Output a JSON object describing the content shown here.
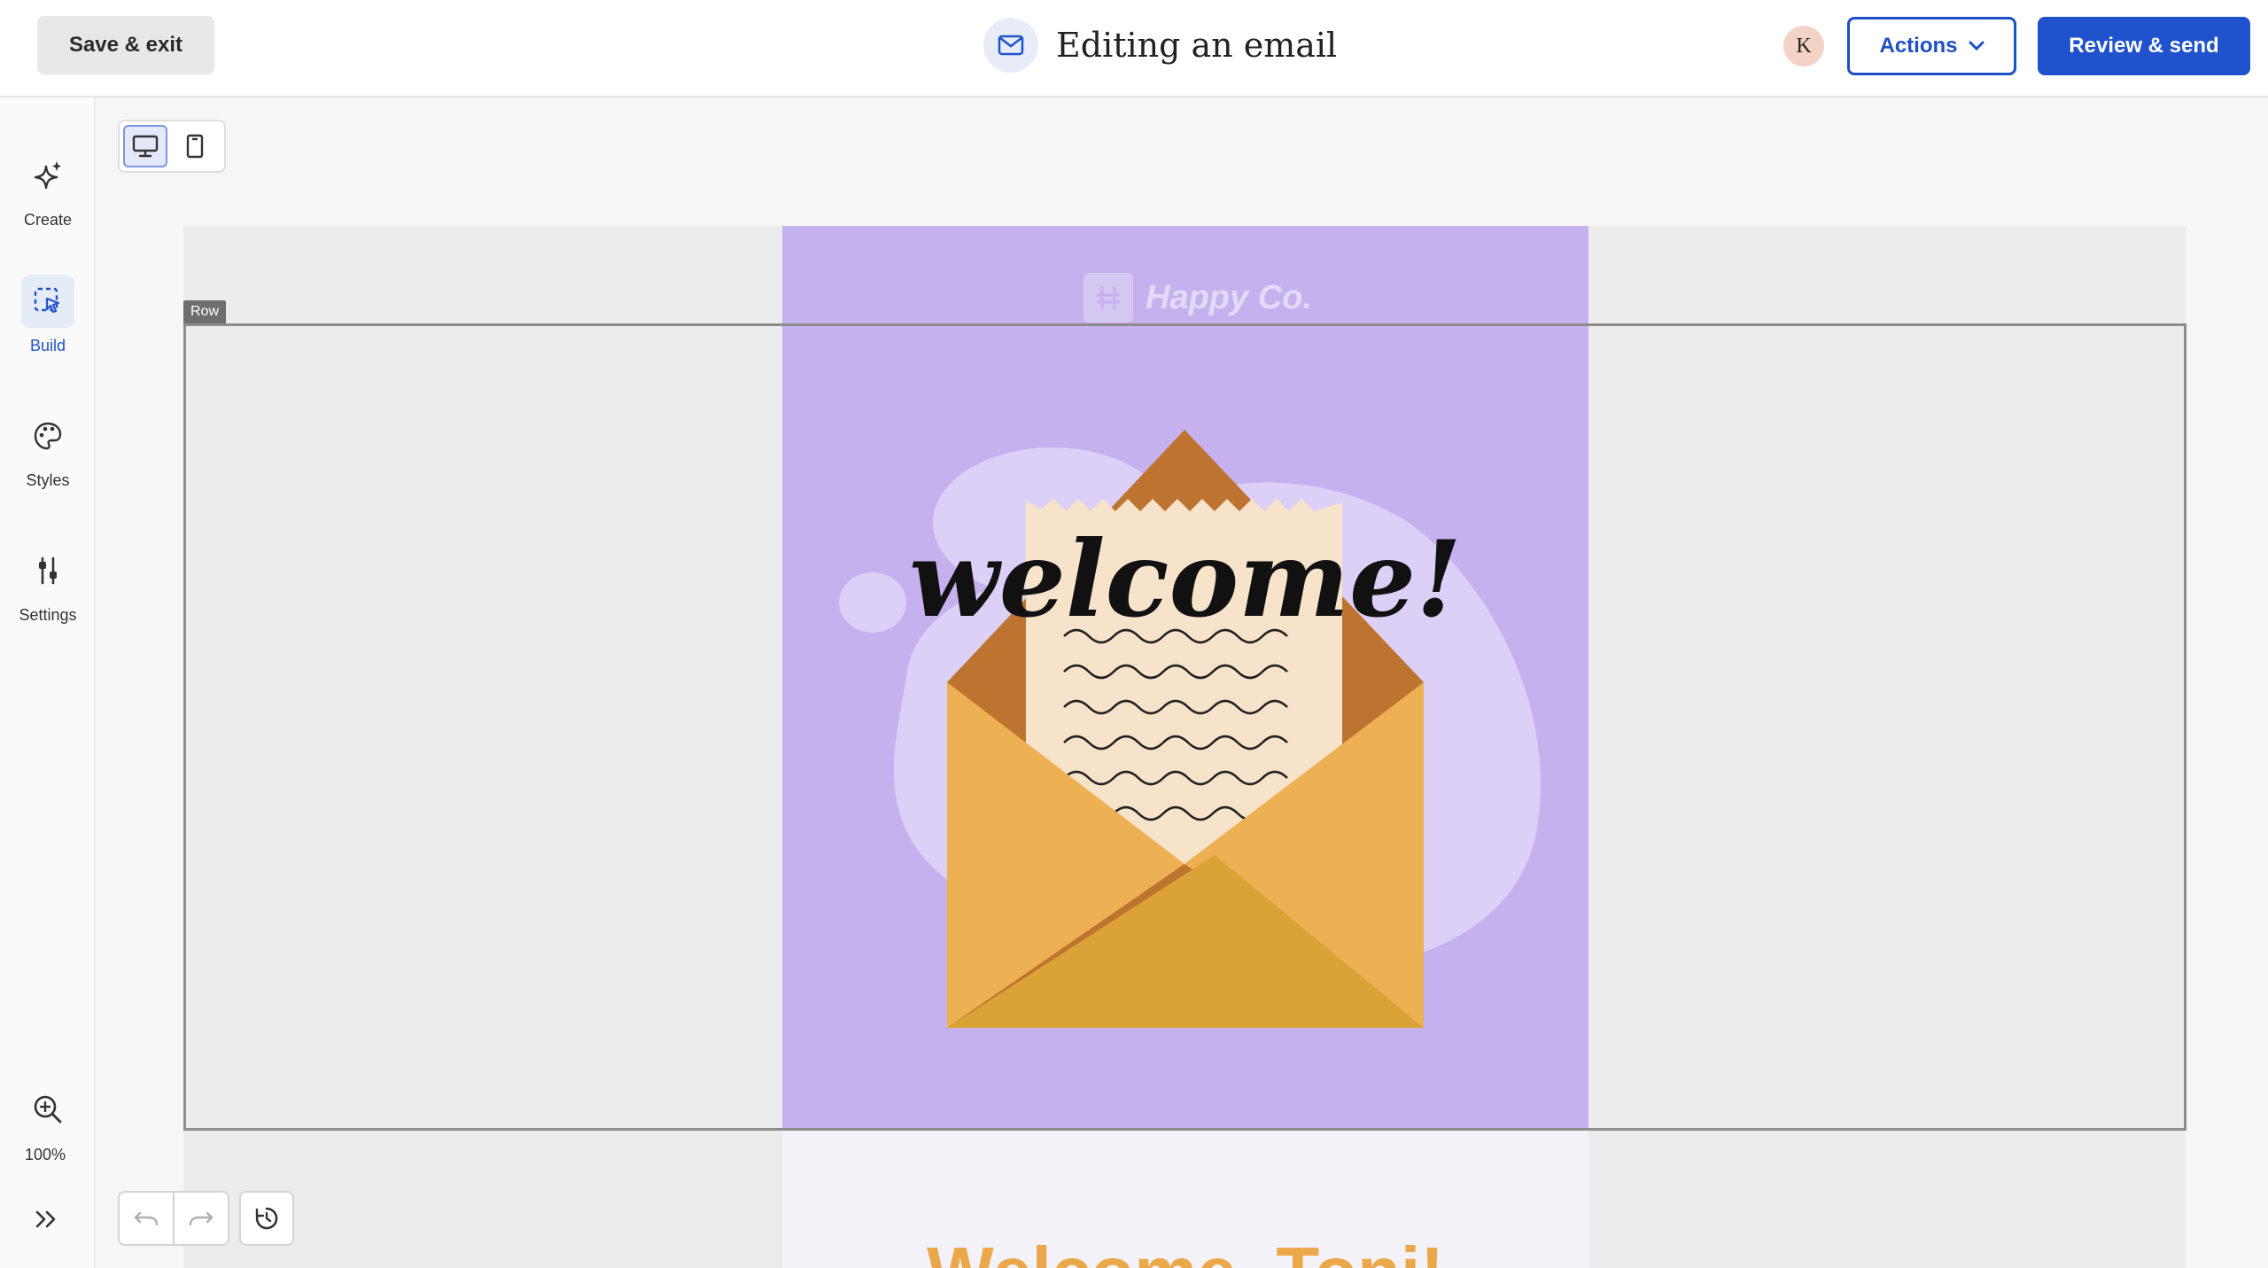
{
  "header": {
    "save_exit_label": "Save & exit",
    "title": "Editing an email",
    "avatar_initial": "K",
    "actions_label": "Actions",
    "review_send_label": "Review & send"
  },
  "sidebar": {
    "items": [
      {
        "label": "Create",
        "icon": "sparkle-icon",
        "active": false
      },
      {
        "label": "Build",
        "icon": "select-pointer-icon",
        "active": true
      },
      {
        "label": "Styles",
        "icon": "palette-icon",
        "active": false
      },
      {
        "label": "Settings",
        "icon": "sliders-icon",
        "active": false
      }
    ],
    "zoom_label": "100%"
  },
  "device_toggle": {
    "options": [
      "desktop-icon",
      "mobile-icon"
    ],
    "selected": "desktop"
  },
  "canvas": {
    "row_tag": "Row",
    "logo_text": "Happy Co.",
    "hero_text": "welcome!",
    "heading": "Welcome, Toni!"
  },
  "colors": {
    "primary": "#1f52cc",
    "hero_bg": "#c4b1ee",
    "heading": "#eaa84a",
    "envelope": "#eeb055"
  }
}
